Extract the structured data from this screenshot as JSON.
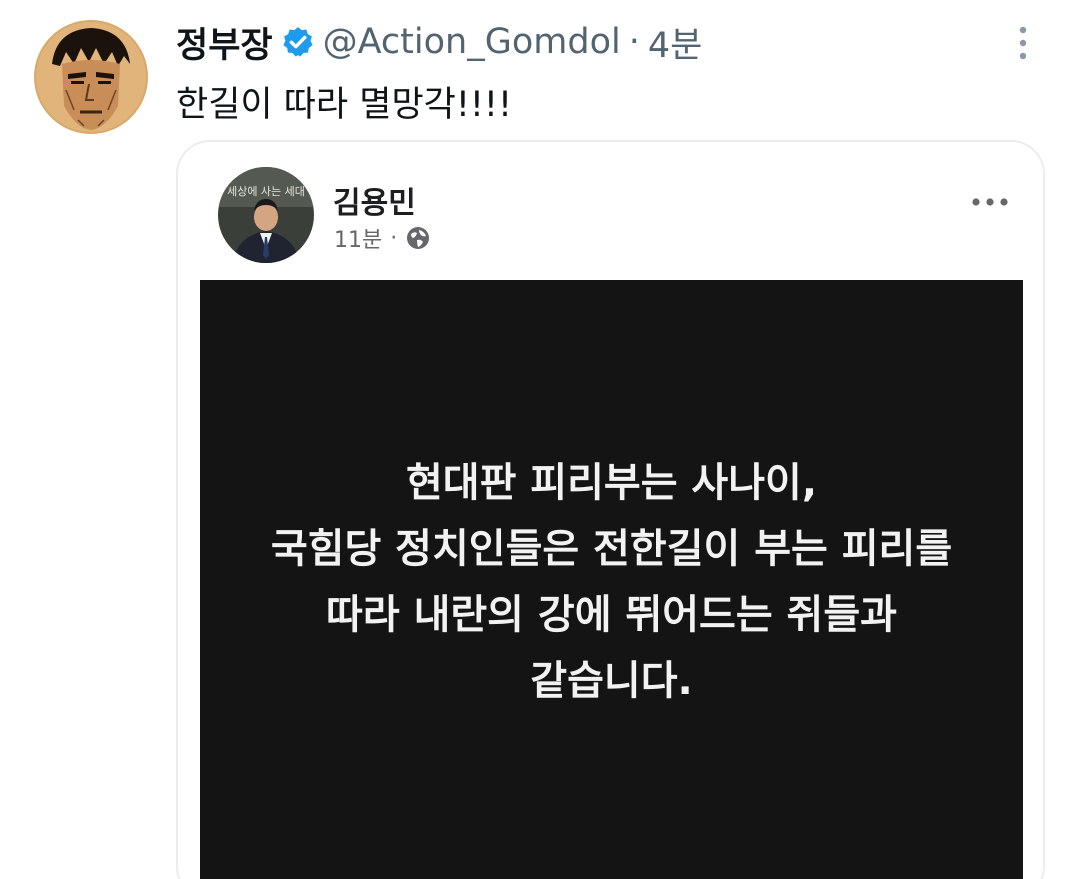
{
  "tweet": {
    "display_name": "정부장",
    "handle": "@Action_Gomdol",
    "separator": "·",
    "time": "4분",
    "text": "한길이 따라 멸망각!!!!"
  },
  "embedded_post": {
    "author": "김용민",
    "time": "11분",
    "separator": "·",
    "avatar_caption": "세상에 사는 세대",
    "image_lines": [
      "현대판 피리부는 사나이,",
      "국힘당 정치인들은 전한길이 부는 피리를",
      "따라 내란의 강에 뛰어드는 쥐들과",
      "같습니다."
    ]
  },
  "colors": {
    "verified_blue": "#1d9bf0",
    "text_primary": "#0f1419",
    "text_secondary": "#536471",
    "image_background": "#141414"
  },
  "icons": [
    "verified-badge-icon",
    "more-vertical-icon",
    "more-horizontal-icon",
    "globe-icon"
  ]
}
